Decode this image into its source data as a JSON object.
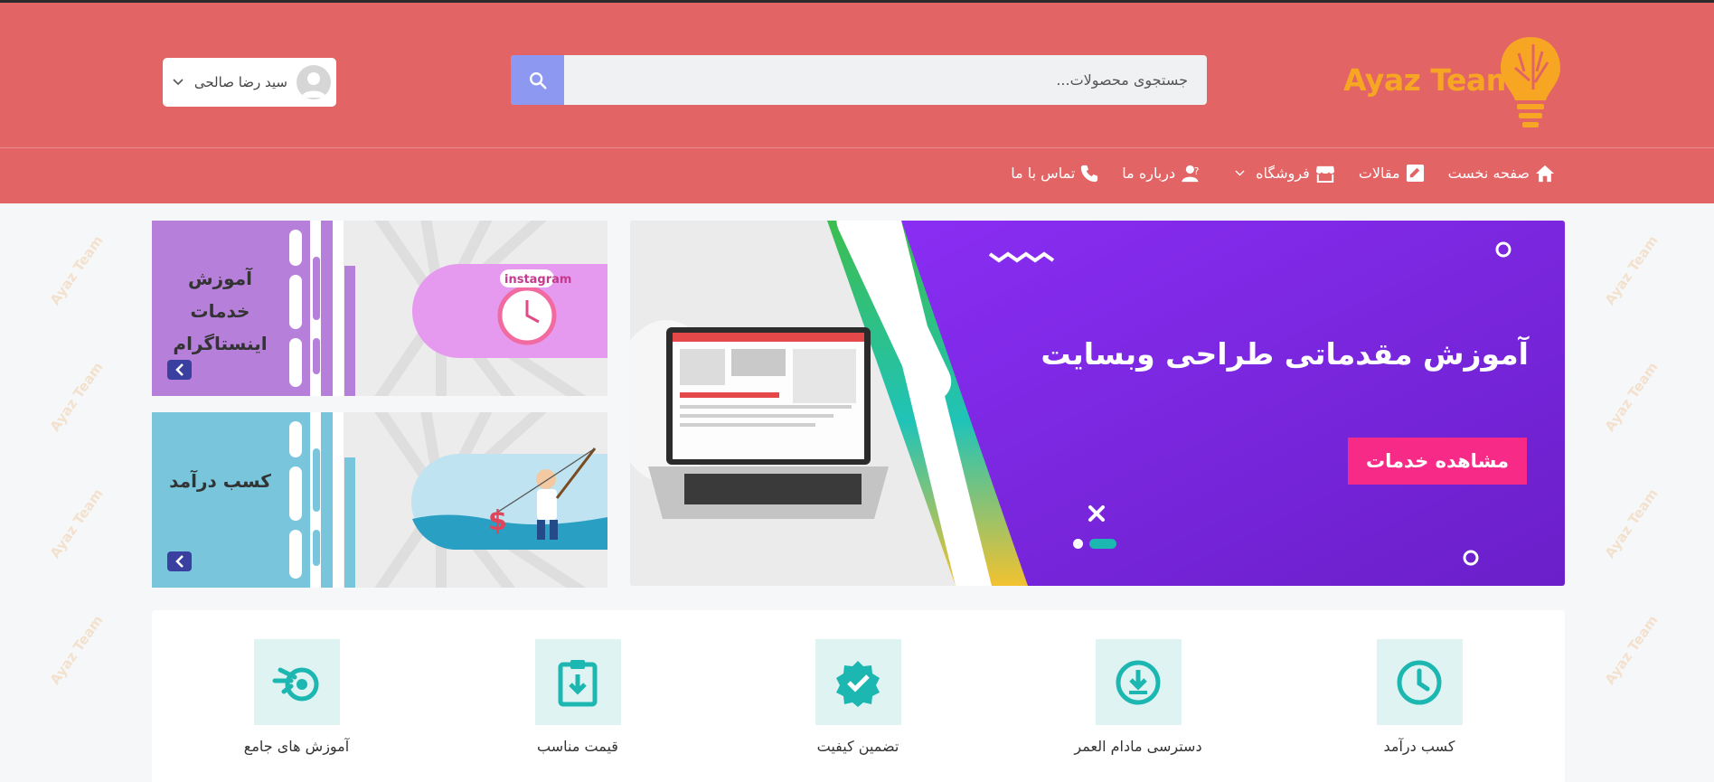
{
  "brand": {
    "logo_text": "Ayaz Team",
    "accent_color": "#e36464",
    "logo_color": "#f6a623",
    "teal_color": "#1cb7b0"
  },
  "search": {
    "placeholder": "جستجوی محصولات...",
    "button_icon": "search-icon"
  },
  "user": {
    "name": "سید رضا صالحی",
    "avatar_icon": "avatar-placeholder-icon"
  },
  "nav": {
    "items": [
      {
        "label": "صفحه نخست",
        "icon": "home-icon"
      },
      {
        "label": "مقالات",
        "icon": "article-edit-icon"
      },
      {
        "label": "فروشگاه",
        "icon": "store-icon",
        "has_dropdown": true
      },
      {
        "label": "درباره ما",
        "icon": "user-question-icon"
      },
      {
        "label": "تماس با ما",
        "icon": "phone-icon"
      }
    ]
  },
  "hero": {
    "title": "آموزش مقدماتی طراحی وبسایت",
    "cta_label": "مشاهده خدمات",
    "slides_count": 2,
    "active_slide": 2
  },
  "side_banners": [
    {
      "title": "آموزش خدمات اینستاگرام",
      "badge": "instagram",
      "color": "#b67fda"
    },
    {
      "title": "کسب درآمد",
      "color": "#79c6dc"
    }
  ],
  "features": [
    {
      "label": "کسب درآمد",
      "icon": "clock-icon"
    },
    {
      "label": "دسترسی مادام العمر",
      "icon": "download-circle-icon"
    },
    {
      "label": "تضمین کیفیت",
      "icon": "verified-badge-icon"
    },
    {
      "label": "قیمت مناسب",
      "icon": "clipboard-download-icon"
    },
    {
      "label": "آموزش های جامع",
      "icon": "blender-icon"
    }
  ]
}
